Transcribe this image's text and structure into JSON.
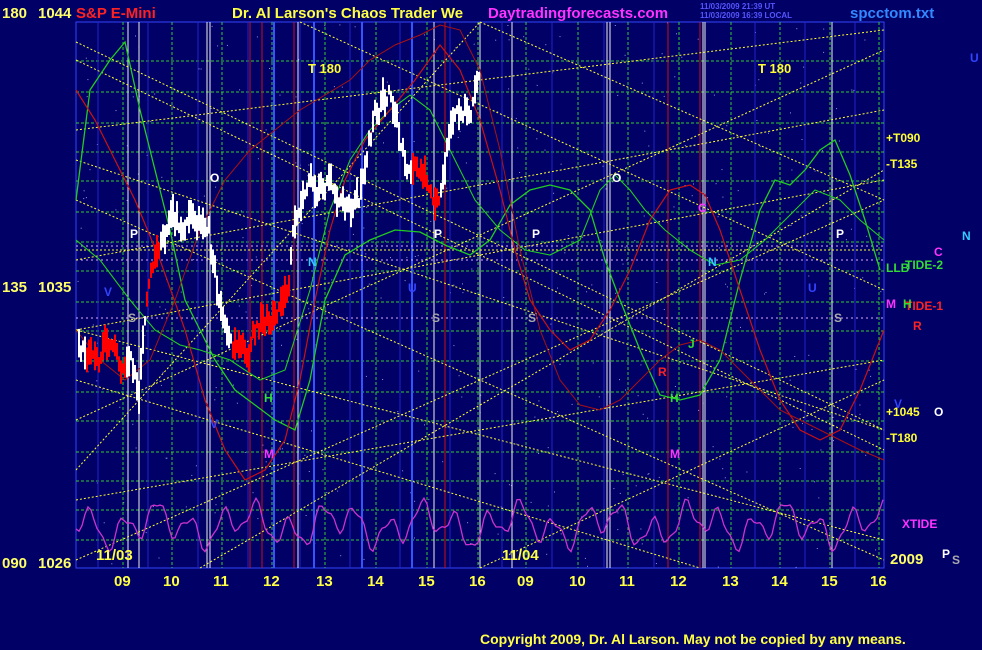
{
  "header": {
    "symbol": "S&P E-Mini",
    "title": "Dr. Al Larson's Chaos Trader We",
    "website": "Daytradingforecasts.com",
    "stamp_utc": "11/03/2009 21:39 UT",
    "stamp_local": "11/03/2009 16:39 LOCAL",
    "filename": "spcctom.txt"
  },
  "y_axis": [
    {
      "angle": "180",
      "price": "1044"
    },
    {
      "angle": "135",
      "price": "1035"
    },
    {
      "angle": "090",
      "price": "1026"
    }
  ],
  "x_axis": {
    "ticks": [
      "09",
      "10",
      "11",
      "12",
      "13",
      "14",
      "15",
      "16",
      "09",
      "10",
      "11",
      "12",
      "13",
      "14",
      "15",
      "16"
    ],
    "dates": [
      "11/03",
      "11/04"
    ],
    "year": "2009"
  },
  "side_labels": {
    "t090": "+T090",
    "t135": "-T135",
    "t1045": "+1045",
    "t180": "-T180",
    "llb": "LLB",
    "tide2": "TIDE-2",
    "tide1": "TIDE-1",
    "xtide": "XTIDE",
    "c": "C",
    "n": "N",
    "m": "M",
    "h": "H",
    "r": "R",
    "o": "O",
    "u": "U",
    "p": "P",
    "s": "S"
  },
  "t180_label": "T 180",
  "footer": {
    "copyright": "Copyright 2009, Dr. Al Larson. May not be copied by any means."
  },
  "colors": {
    "background": "#000066",
    "price_up": "#ffffff",
    "price_down": "#ff0000",
    "grid_yellow": "#ffff33",
    "grid_green": "#33cc33",
    "tide_green": "#22cc22",
    "tide_red": "#cc1111",
    "xtide": "#cc33cc",
    "yellow_label": "#ffff33"
  },
  "chart_data": {
    "type": "candlestick",
    "title": "S&P E-Mini",
    "ylim": [
      1026,
      1044
    ],
    "x": [
      "11/03 09",
      "10",
      "11",
      "12",
      "13",
      "14",
      "15",
      "16",
      "11/04 09",
      "10",
      "11",
      "12",
      "13",
      "14",
      "15",
      "16"
    ],
    "series": [
      {
        "name": "price",
        "kind": "hourly close estimate",
        "x": [
          "11/03 09",
          "10",
          "11",
          "12",
          "13",
          "14",
          "15",
          "16"
        ],
        "values": [
          1031,
          1038,
          1037,
          1032,
          1039,
          1042,
          1038,
          1042
        ]
      },
      {
        "name": "TIDE-1",
        "color": "#cc1111"
      },
      {
        "name": "TIDE-2",
        "color": "#22cc22"
      },
      {
        "name": "XTIDE",
        "color": "#cc33cc"
      }
    ],
    "markers": [
      "P",
      "S",
      "O",
      "N",
      "M",
      "H",
      "U",
      "J",
      "R",
      "C",
      "V"
    ]
  }
}
